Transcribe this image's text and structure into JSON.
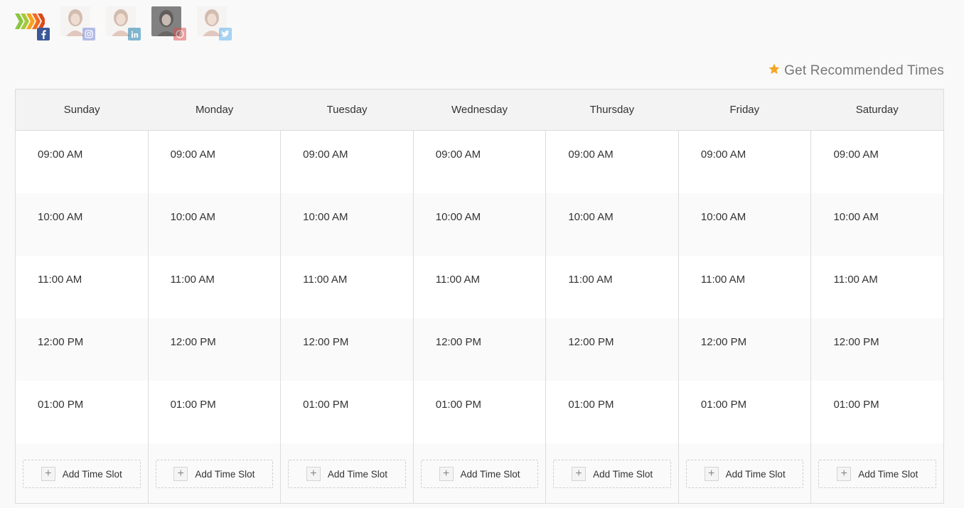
{
  "profiles": [
    {
      "network": "facebook",
      "icon": "facebook-icon",
      "badge_color": "#3b5998",
      "active": true
    },
    {
      "network": "instagram",
      "icon": "instagram-icon",
      "badge_color": "#6f7fd6",
      "active": false
    },
    {
      "network": "linkedin",
      "icon": "linkedin-icon",
      "badge_color": "#0e76a8",
      "active": false
    },
    {
      "network": "pinterest",
      "icon": "pinterest-icon",
      "badge_color": "#e04a4a",
      "active": false
    },
    {
      "network": "twitter",
      "icon": "twitter-icon",
      "badge_color": "#55acee",
      "active": false
    }
  ],
  "recommend": {
    "label": "Get Recommended Times",
    "icon": "star-icon",
    "icon_color": "#f4a623"
  },
  "days": [
    {
      "name": "Sunday",
      "slots": [
        "09:00 AM",
        "10:00 AM",
        "11:00 AM",
        "12:00 PM",
        "01:00 PM"
      ]
    },
    {
      "name": "Monday",
      "slots": [
        "09:00 AM",
        "10:00 AM",
        "11:00 AM",
        "12:00 PM",
        "01:00 PM"
      ]
    },
    {
      "name": "Tuesday",
      "slots": [
        "09:00 AM",
        "10:00 AM",
        "11:00 AM",
        "12:00 PM",
        "01:00 PM"
      ]
    },
    {
      "name": "Wednesday",
      "slots": [
        "09:00 AM",
        "10:00 AM",
        "11:00 AM",
        "12:00 PM",
        "01:00 PM"
      ]
    },
    {
      "name": "Thursday",
      "slots": [
        "09:00 AM",
        "10:00 AM",
        "11:00 AM",
        "12:00 PM",
        "01:00 PM"
      ]
    },
    {
      "name": "Friday",
      "slots": [
        "09:00 AM",
        "10:00 AM",
        "11:00 AM",
        "12:00 PM",
        "01:00 PM"
      ]
    },
    {
      "name": "Saturday",
      "slots": [
        "09:00 AM",
        "10:00 AM",
        "11:00 AM",
        "12:00 PM",
        "01:00 PM"
      ]
    }
  ],
  "add_slot_label": "Add Time Slot"
}
